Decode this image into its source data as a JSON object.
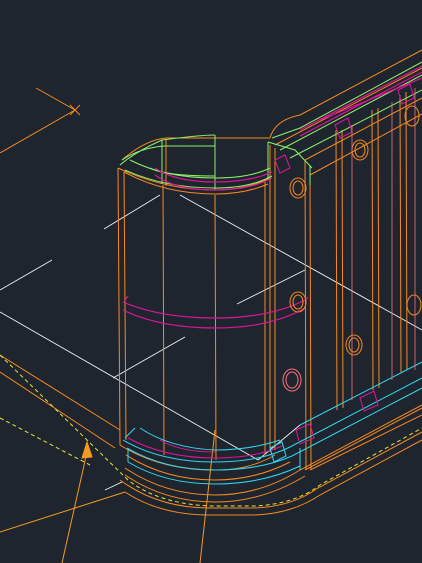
{
  "canvas": {
    "background": "#1f252e"
  },
  "drawing": {
    "colors": {
      "orange": "#f7891f",
      "green": "#8cf06a",
      "magenta": "#e0149a",
      "cyan": "#2fd6f0",
      "white": "#eef2f7",
      "yellow_dashed": "#e6e23a",
      "pink": "#ff6f7a",
      "arrow": "#f59a1f"
    },
    "icons": [
      "ucs-origin-cross-icon",
      "arrowhead-icon"
    ]
  }
}
